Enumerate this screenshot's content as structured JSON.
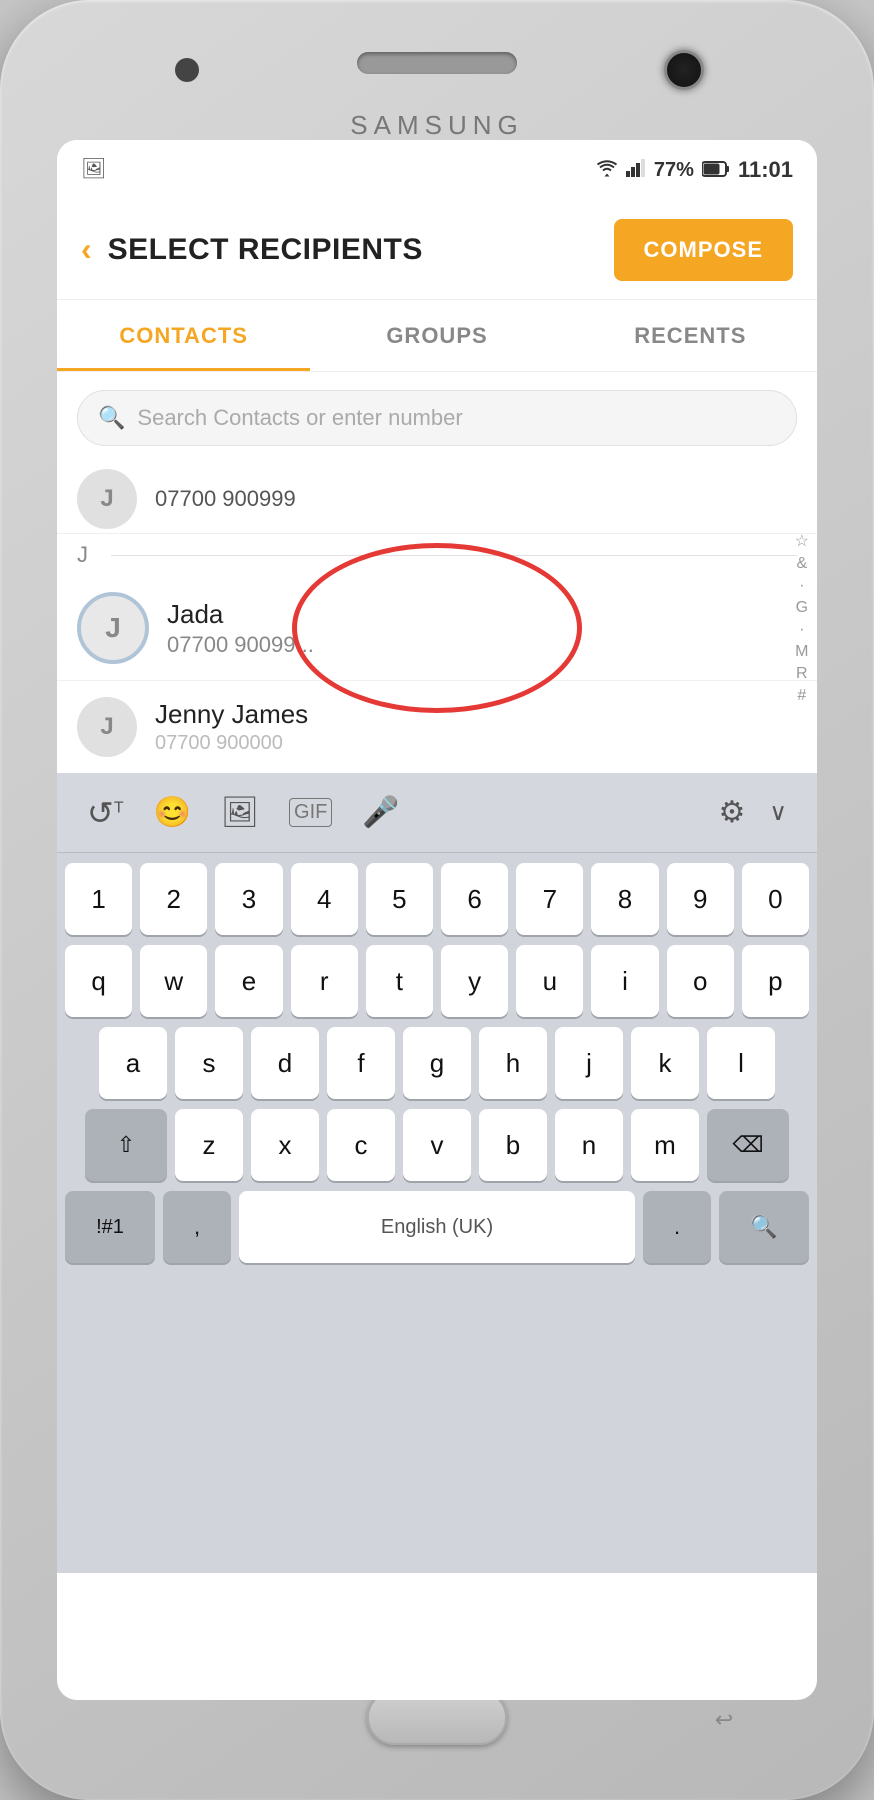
{
  "device": {
    "brand": "SAMSUNG"
  },
  "status_bar": {
    "time": "11:01",
    "battery": "77%",
    "signal_icon": "📶",
    "wifi_icon": "📶"
  },
  "header": {
    "title": "SELECT RECIPIENTS",
    "back_icon": "‹",
    "compose_label": "COMPOSE"
  },
  "tabs": [
    {
      "id": "contacts",
      "label": "CONTACTS",
      "active": true
    },
    {
      "id": "groups",
      "label": "GROUPS",
      "active": false
    },
    {
      "id": "recents",
      "label": "RECENTS",
      "active": false
    }
  ],
  "search": {
    "placeholder": "Search Contacts or enter number"
  },
  "contacts": {
    "partial_top": {
      "phone": "07700 900999"
    },
    "section_j_letter": "J",
    "jada": {
      "initial": "J",
      "name": "Jada",
      "phone": "07700 90099..."
    },
    "jenny": {
      "initial": "J",
      "name": "Jenny James",
      "phone": "07700 900000"
    }
  },
  "alphabet_index": [
    "☆",
    "&",
    "·",
    "G",
    "·",
    "M",
    "R",
    "#"
  ],
  "keyboard": {
    "toolbar_icons": [
      "↺T",
      "😊",
      "🖼",
      "GIF",
      "🎤",
      "⚙",
      "∨"
    ],
    "rows": [
      [
        "1",
        "2",
        "3",
        "4",
        "5",
        "6",
        "7",
        "8",
        "9",
        "0"
      ],
      [
        "q",
        "w",
        "e",
        "r",
        "t",
        "y",
        "u",
        "i",
        "o",
        "p"
      ],
      [
        "a",
        "s",
        "d",
        "f",
        "g",
        "h",
        "j",
        "k",
        "l"
      ],
      [
        "⇧",
        "z",
        "x",
        "c",
        "v",
        "b",
        "n",
        "m",
        "⌫"
      ],
      [
        "!#1",
        ",",
        "English (UK)",
        ".",
        "🔍"
      ]
    ]
  }
}
